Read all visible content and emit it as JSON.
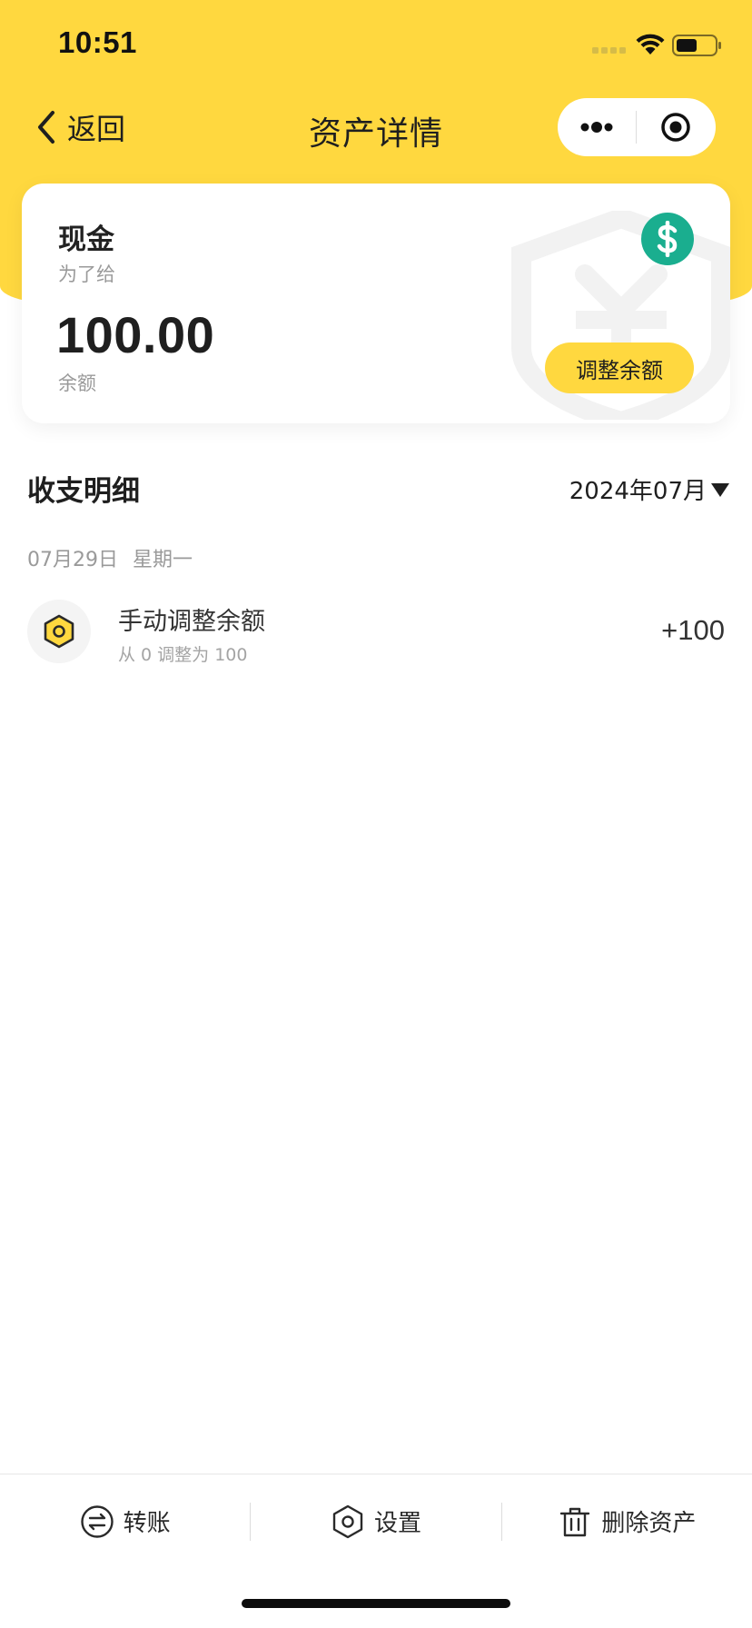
{
  "status_bar": {
    "time": "10:51"
  },
  "nav": {
    "back_label": "返回",
    "title": "资产详情",
    "more_icon": "more-dots-icon",
    "close_icon": "target-close-icon"
  },
  "asset": {
    "name": "现金",
    "note": "为了给",
    "balance": "100.00",
    "balance_label": "余额",
    "icon": "dollar-icon",
    "icon_color": "#1AAE8F",
    "adjust_button_label": "调整余额"
  },
  "transactions": {
    "section_title": "收支明细",
    "month": "2024年07月",
    "day": {
      "date": "07月29日",
      "weekday": "星期一",
      "items": [
        {
          "title": "手动调整余额",
          "subtitle": "从 0 调整为 100",
          "amount": "+100",
          "icon": "hexagon-icon"
        }
      ]
    }
  },
  "bottom_bar": {
    "actions": [
      {
        "label": "转账",
        "icon": "transfer-icon"
      },
      {
        "label": "设置",
        "icon": "settings-hexagon-icon"
      },
      {
        "label": "删除资产",
        "icon": "trash-icon"
      }
    ]
  },
  "colors": {
    "brand_yellow": "#FFD83F",
    "accent_green": "#1AAE8F"
  }
}
